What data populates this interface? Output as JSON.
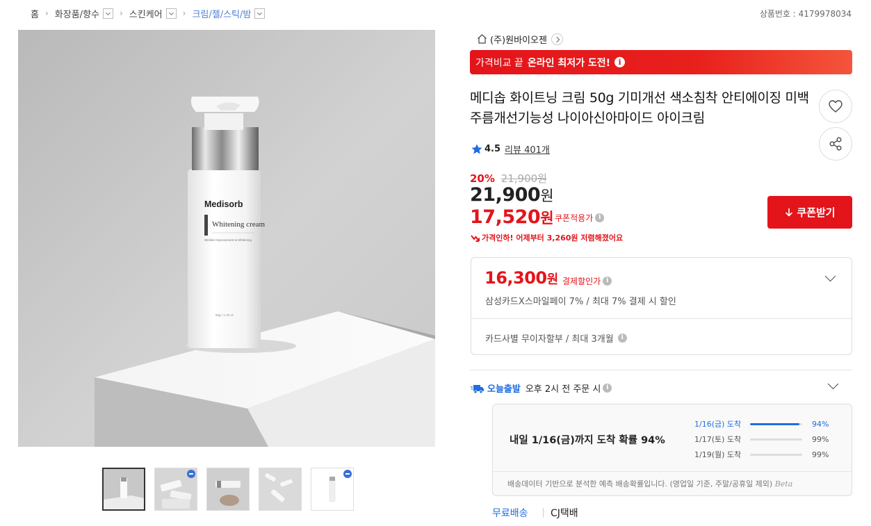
{
  "breadcrumb": {
    "home": "홈",
    "level1": "화장품/향수",
    "level2": "스킨케어",
    "level3": "크림/젤/스틱/밤"
  },
  "product_number": "상품번호 : 4179978034",
  "image": {
    "brand_text": "Medisorb",
    "product_text": "Whitening cream",
    "sub_text": "Wrinkle Improvement & Whitening",
    "volume_text": "50g / 1.76 oz"
  },
  "thumbnails": [
    {
      "selected": true,
      "badge": false
    },
    {
      "selected": false,
      "badge": true
    },
    {
      "selected": false,
      "badge": false
    },
    {
      "selected": false,
      "badge": false
    },
    {
      "selected": false,
      "badge": true
    }
  ],
  "seller": "(주)원바이오젠",
  "promo": {
    "prefix": "가격비교 끝",
    "highlight": "온라인 최저가 도전!",
    "info": "i"
  },
  "title": "메디솝 화이트닝 크림 50g 기미개선 색소침착 안티에이징 미백주름개선기능성 나이아신아마이드 아이크림",
  "rating": {
    "score": "4.5",
    "reviews": "리뷰 401개"
  },
  "pricing": {
    "discount_pct": "20%",
    "original_price": "21,900원",
    "sale_price": "21,900",
    "sale_unit": "원",
    "coupon_price": "17,520",
    "coupon_unit": "원",
    "coupon_label": "쿠폰적용가",
    "price_drop_note": "가격인하! 어제부터 3,260원 저렴해졌어요",
    "coupon_button": "쿠폰받기"
  },
  "payment": {
    "price": "16,300",
    "unit": "원",
    "label": "결제할인가",
    "desc": "삼성카드X스마일페이 7% / 최대 7% 결제 시 할인",
    "installment": "카드사별 무이자할부 / 최대 3개월"
  },
  "shipping": {
    "today_label": "오늘출발",
    "cutoff": "오후 2시 전 주문 시",
    "headline": "내일 1/16(금)까지 도착 확률 94%",
    "rows": [
      {
        "date": "1/16(금) 도착",
        "pct": "94%",
        "value": 0.94
      },
      {
        "date": "1/17(토) 도착",
        "pct": "99%",
        "value": 0.99
      },
      {
        "date": "1/19(월) 도착",
        "pct": "99%",
        "value": 0.99
      }
    ],
    "note": "배송데이터 기반으로 분석한 예측 배송확률입니다. (영업일 기준, 주말/공휴일 제외)",
    "beta": "Beta",
    "free": "무료배송",
    "courier": "CJ택배"
  },
  "colors": {
    "accent_red": "#e4141b",
    "accent_blue": "#1f6de0"
  }
}
